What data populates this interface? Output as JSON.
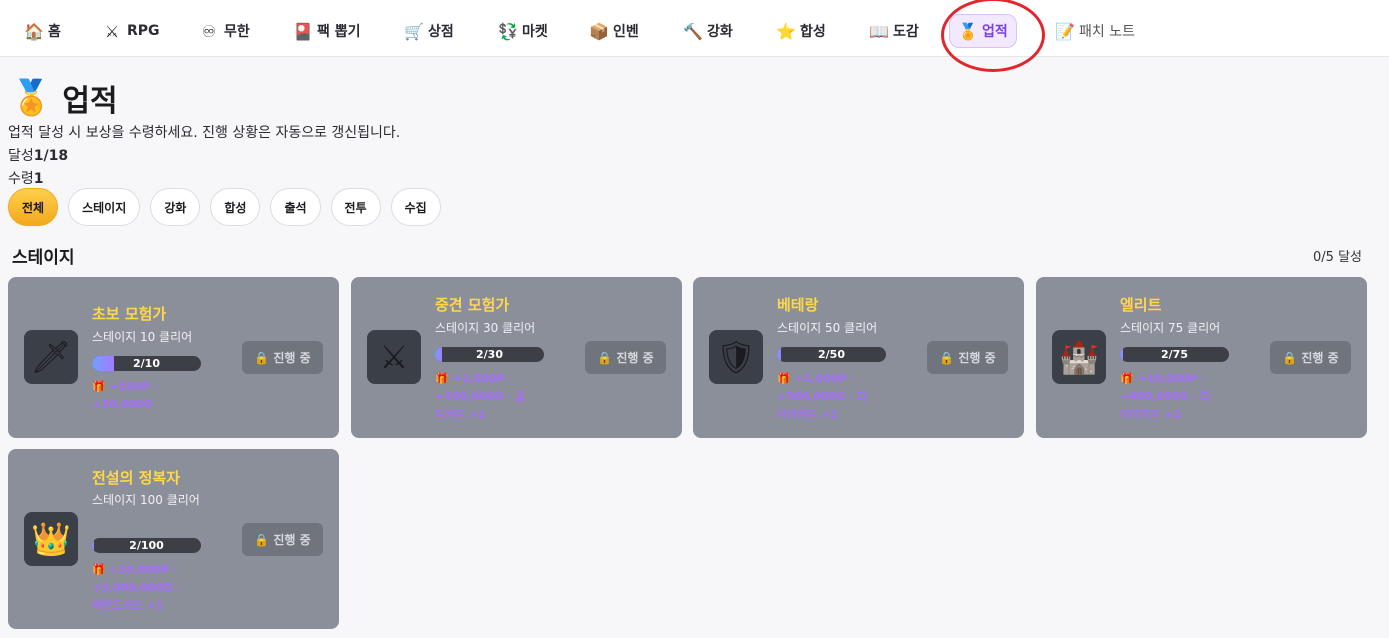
{
  "nav": {
    "items": [
      {
        "icon": "🏠",
        "label": "홈"
      },
      {
        "icon": "⚔",
        "label": "RPG"
      },
      {
        "icon": "♾",
        "label": "무한"
      },
      {
        "icon": "🎴",
        "label": "팩 뽑기"
      },
      {
        "icon": "🛒",
        "label": "상점"
      },
      {
        "icon": "💱",
        "label": "마켓"
      },
      {
        "icon": "📦",
        "label": "인벤"
      },
      {
        "icon": "🔨",
        "label": "강화"
      },
      {
        "icon": "⭐",
        "label": "합성"
      },
      {
        "icon": "📖",
        "label": "도감"
      },
      {
        "icon": "🏅",
        "label": "업적"
      },
      {
        "icon": "📝",
        "label": "패치 노트"
      }
    ],
    "active_index": 10
  },
  "header": {
    "icon": "🏅",
    "title": "업적",
    "subtitle": "업적 달성 시 보상을 수령하세요. 진행 상황은 자동으로 갱신됩니다.",
    "achieved_label": "달성",
    "achieved_value": "1/18",
    "claimed_label": "수령",
    "claimed_value": "1"
  },
  "filters": [
    "전체",
    "스테이지",
    "강화",
    "합성",
    "출석",
    "전투",
    "수집"
  ],
  "active_filter": "전체",
  "section": {
    "title": "스테이지",
    "count": "0/5 달성"
  },
  "status_icon": "🔒",
  "reward_icon": "🎁",
  "cards": [
    {
      "icon": "🗡",
      "name": "초보 모험가",
      "desc": "스테이지 10 클리어",
      "progress": "2/10",
      "fraction": 0.2,
      "reward": "+500P · +20,000G",
      "status": "진행 중"
    },
    {
      "icon": "⚔",
      "name": "중견 모험가",
      "desc": "스테이지 30 클리어",
      "progress": "2/30",
      "fraction": 0.067,
      "reward": "+2,000P · +100,000G · 골드카드 ×1",
      "status": "진행 중"
    },
    {
      "icon": "🛡",
      "name": "베테랑",
      "desc": "스테이지 50 클리어",
      "progress": "2/50",
      "fraction": 0.04,
      "reward": "+5,000P · +300,000G · 다이아카드 ×1",
      "status": "진행 중"
    },
    {
      "icon": "🏰",
      "name": "엘리트",
      "desc": "스테이지 75 클리어",
      "progress": "2/75",
      "fraction": 0.027,
      "reward": "+10,000P · +800,000G · 다이아카드 ×2",
      "status": "진행 중"
    },
    {
      "icon": "👑",
      "name": "전설의 정복자",
      "desc": "스테이지 100 클리어",
      "progress": "2/100",
      "fraction": 0.02,
      "reward": "+30,000P · +3,000,000G · 레전드카드 ×1",
      "status": "진행 중"
    }
  ]
}
